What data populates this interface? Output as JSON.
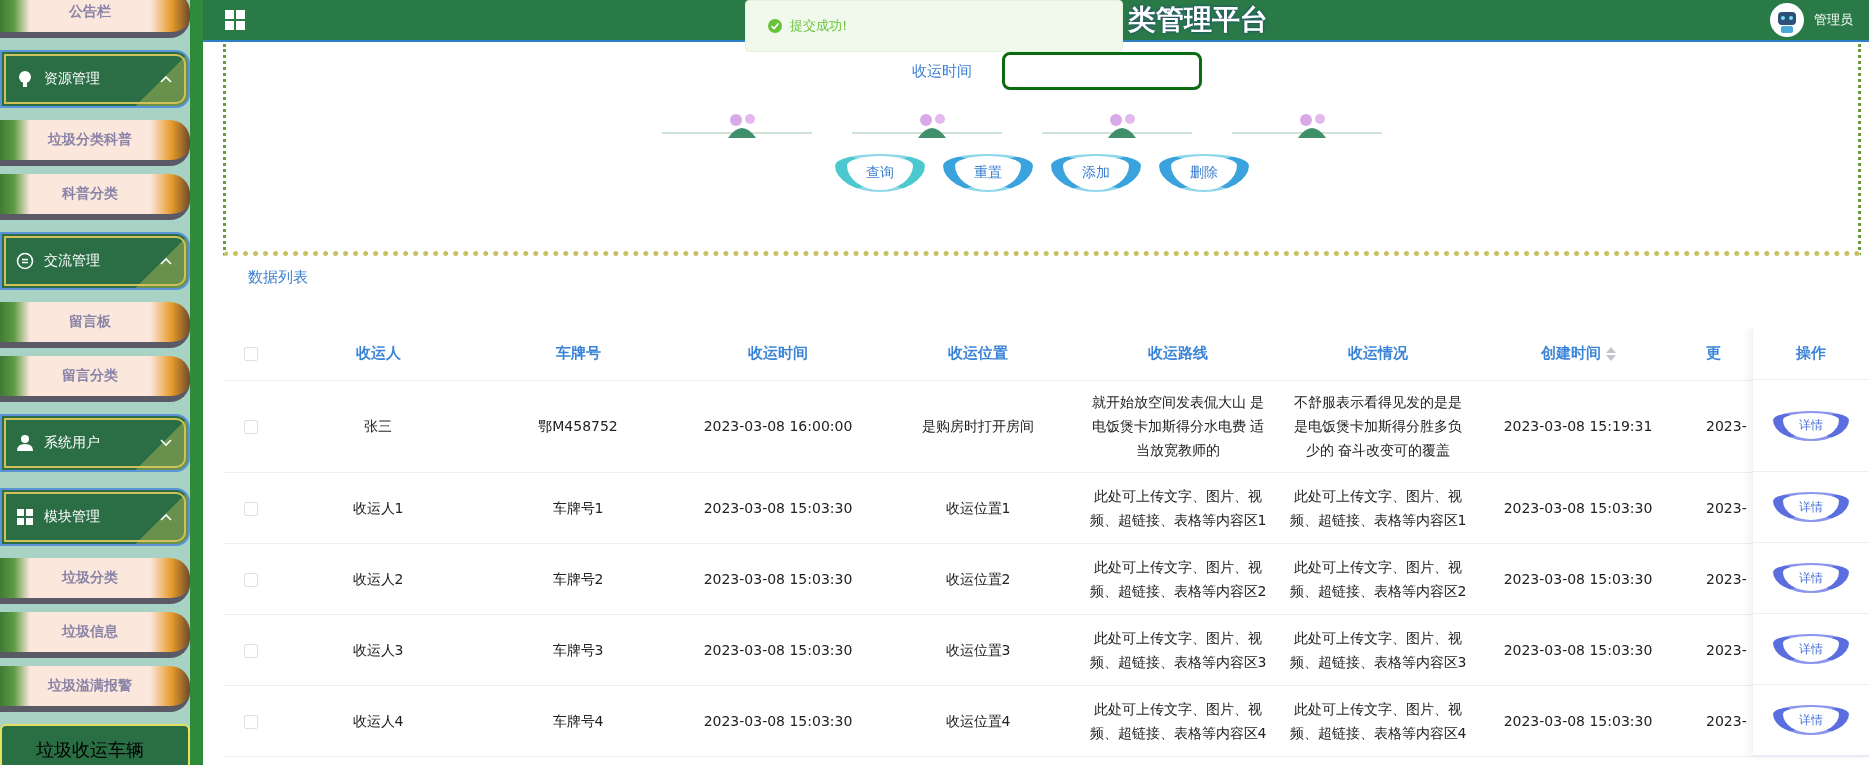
{
  "header": {
    "title": "类管理平台",
    "user": "管理员"
  },
  "toast": {
    "message": "提交成功!"
  },
  "sidebar": {
    "items": [
      {
        "kind": "item",
        "label": "公告栏",
        "selected": false
      },
      {
        "kind": "group",
        "label": "资源管理",
        "expanded": true,
        "children": [
          {
            "kind": "item",
            "label": "垃圾分类科普",
            "selected": false
          },
          {
            "kind": "item",
            "label": "科普分类",
            "selected": false
          }
        ]
      },
      {
        "kind": "group",
        "label": "交流管理",
        "expanded": true,
        "children": [
          {
            "kind": "item",
            "label": "留言板",
            "selected": false
          },
          {
            "kind": "item",
            "label": "留言分类",
            "selected": false
          }
        ]
      },
      {
        "kind": "group",
        "label": "系统用户",
        "expanded": false
      },
      {
        "kind": "group",
        "label": "模块管理",
        "expanded": true,
        "children": [
          {
            "kind": "item",
            "label": "垃圾分类",
            "selected": false
          },
          {
            "kind": "item",
            "label": "垃圾信息",
            "selected": false
          },
          {
            "kind": "item",
            "label": "垃圾溢满报警",
            "selected": false
          },
          {
            "kind": "item",
            "label": "垃圾收运车辆",
            "selected": true
          }
        ]
      }
    ]
  },
  "search": {
    "fields": [
      {
        "label": "收运时间"
      }
    ],
    "buttons": [
      {
        "label": "查询",
        "color": "#4cc9cf"
      },
      {
        "label": "重置",
        "color": "#3aa3dd"
      },
      {
        "label": "添加",
        "color": "#3aa3dd"
      },
      {
        "label": "删除",
        "color": "#3aa3dd"
      }
    ]
  },
  "list_title": "数据列表",
  "table": {
    "all_checked": false,
    "columns": [
      {
        "label": "收运人"
      },
      {
        "label": "车牌号"
      },
      {
        "label": "收运时间"
      },
      {
        "label": "收运位置"
      },
      {
        "label": "收运路线"
      },
      {
        "label": "收运情况"
      },
      {
        "label": "创建时间",
        "sortable": true
      },
      {
        "label": "更"
      }
    ],
    "action_column": "操作",
    "rows": [
      {
        "checked": false,
        "cells": [
          "张三",
          "鄂M458752",
          "2023-03-08 16:00:00",
          "是购房时打开房间",
          "就开始放空间发表侃大山 是电饭煲卡加斯得分水电费 适当放宽教师的",
          "不舒服表示看得见发的是是是电饭煲卡加斯得分胜多负少的 奋斗改变可的覆盖",
          "2023-03-08 15:19:31",
          "2023-"
        ],
        "action": "详情"
      },
      {
        "checked": false,
        "cells": [
          "收运人1",
          "车牌号1",
          "2023-03-08 15:03:30",
          "收运位置1",
          "此处可上传文字、图片、视频、超链接、表格等内容区1",
          "此处可上传文字、图片、视频、超链接、表格等内容区1",
          "2023-03-08 15:03:30",
          "2023-"
        ],
        "action": "详情"
      },
      {
        "checked": false,
        "cells": [
          "收运人2",
          "车牌号2",
          "2023-03-08 15:03:30",
          "收运位置2",
          "此处可上传文字、图片、视频、超链接、表格等内容区2",
          "此处可上传文字、图片、视频、超链接、表格等内容区2",
          "2023-03-08 15:03:30",
          "2023-"
        ],
        "action": "详情"
      },
      {
        "checked": false,
        "cells": [
          "收运人3",
          "车牌号3",
          "2023-03-08 15:03:30",
          "收运位置3",
          "此处可上传文字、图片、视频、超链接、表格等内容区3",
          "此处可上传文字、图片、视频、超链接、表格等内容区3",
          "2023-03-08 15:03:30",
          "2023-"
        ],
        "action": "详情"
      },
      {
        "checked": false,
        "cells": [
          "收运人4",
          "车牌号4",
          "2023-03-08 15:03:30",
          "收运位置4",
          "此处可上传文字、图片、视频、超链接、表格等内容区4",
          "此处可上传文字、图片、视频、超链接、表格等内容区4",
          "2023-03-08 15:03:30",
          "2023-"
        ],
        "action": "详情"
      }
    ]
  }
}
